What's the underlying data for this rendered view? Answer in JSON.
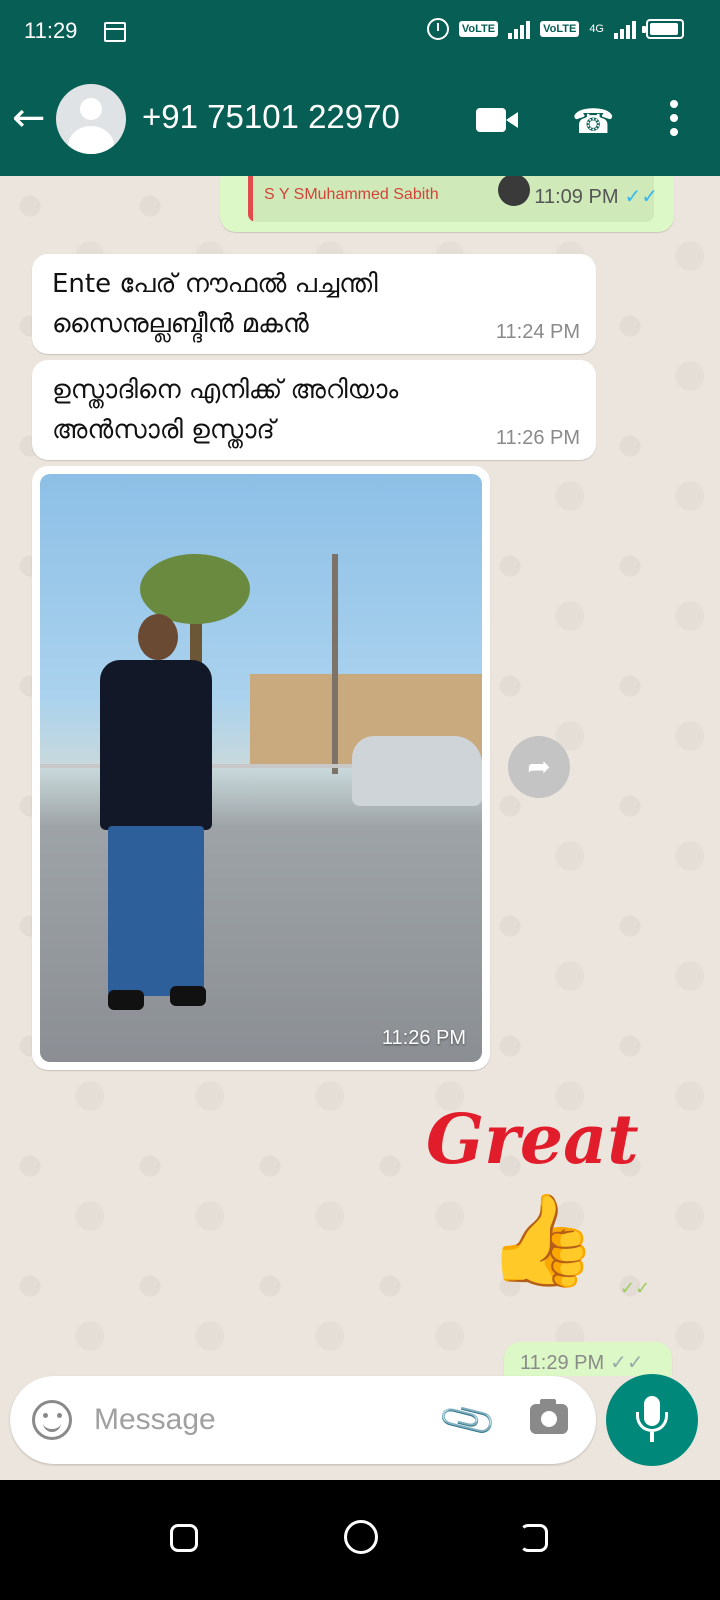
{
  "status_bar": {
    "time": "11:29",
    "network_labels": [
      "VoLTE",
      "VoLTE"
    ],
    "network_type": "4G"
  },
  "header": {
    "contact": "+91 75101 22970",
    "icons": [
      "back-arrow-icon",
      "avatar-icon",
      "video-call-icon",
      "phone-icon",
      "more-options-icon"
    ]
  },
  "messages": [
    {
      "type": "reply-preview",
      "direction": "out",
      "reply_name": "S Y SMuhammed Sabith",
      "time": "11:09 PM"
    },
    {
      "type": "text",
      "direction": "in",
      "text_line1": "Ente പേര് നൗഫൽ പച്ചന്തി",
      "text_line2": "സൈനുല്ലബ്ദീൻ മകൻ",
      "time": "11:24 PM"
    },
    {
      "type": "text",
      "direction": "in",
      "text_line1": "ഉസ്താദിനെ എനിക്ക് അറിയാം",
      "text_line2": "അൻസാരി ഉസ്താദ്",
      "time": "11:26 PM"
    },
    {
      "type": "image",
      "direction": "in",
      "time": "11:26 PM"
    },
    {
      "type": "sticker",
      "direction": "out",
      "sticker_text": "Great",
      "sticker_emoji": "👍"
    },
    {
      "type": "partial",
      "direction": "out",
      "time": "11:29 PM"
    }
  ],
  "composer": {
    "placeholder": "Message",
    "icons": [
      "emoji-icon",
      "attach-icon",
      "camera-icon",
      "mic-icon"
    ]
  },
  "colors": {
    "header": "#075E54",
    "chat_background": "#ECE5DD",
    "outgoing_bubble": "#DCF8C6",
    "incoming_bubble": "#FFFFFF",
    "read_ticks": "#34B7F1",
    "mic_button": "#00897B",
    "sticker_text": "#E21D2B"
  }
}
